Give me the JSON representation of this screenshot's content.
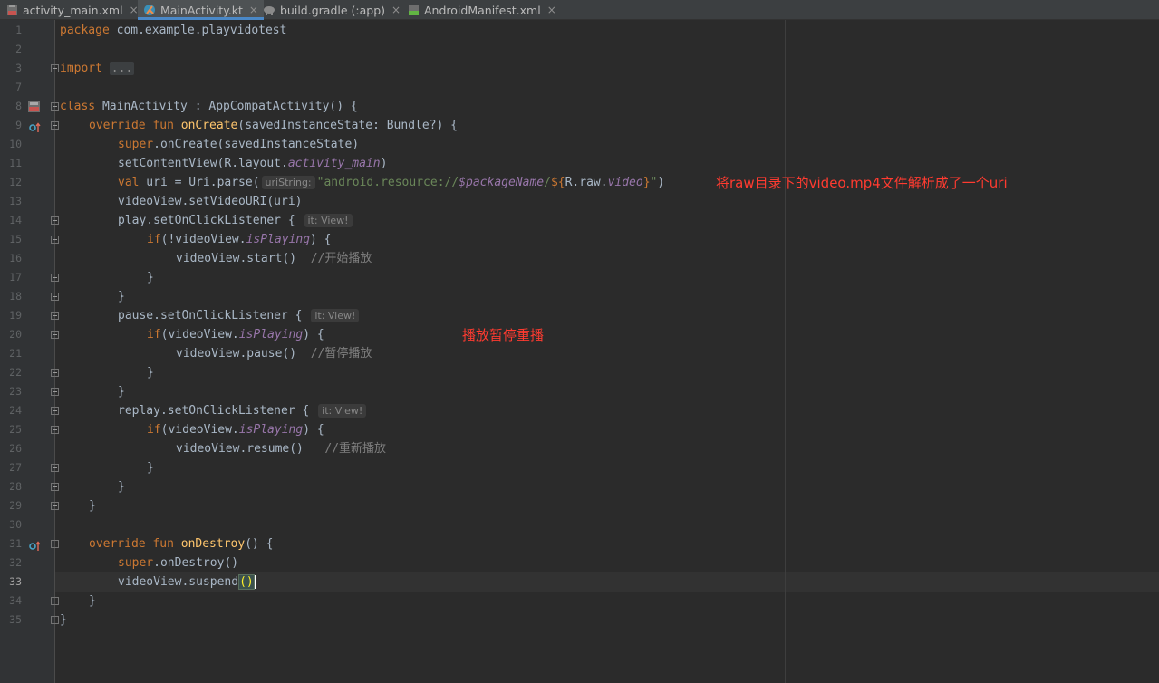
{
  "tabs": [
    {
      "label": "activity_main.xml",
      "icon": "xml-layout-icon",
      "active": false
    },
    {
      "label": "MainActivity.kt",
      "icon": "kotlin-class-icon",
      "active": true
    },
    {
      "label": "build.gradle (:app)",
      "icon": "gradle-elephant-icon",
      "active": false
    },
    {
      "label": "AndroidManifest.xml",
      "icon": "manifest-icon",
      "active": false
    }
  ],
  "close_glyph": "×",
  "line_numbers": [
    "1",
    "2",
    "3",
    "7",
    "8",
    "9",
    "10",
    "11",
    "12",
    "13",
    "14",
    "15",
    "16",
    "17",
    "18",
    "19",
    "20",
    "21",
    "22",
    "23",
    "24",
    "25",
    "26",
    "27",
    "28",
    "29",
    "30",
    "31",
    "32",
    "33",
    "34",
    "35"
  ],
  "current_line": "33",
  "code": {
    "package_kw": "package",
    "package_name": " com.example.playvidotest",
    "import_kw": "import",
    "import_fold": "...",
    "class_kw": "class",
    "class_decl": " MainActivity : AppCompatActivity() {",
    "override_kw": "override fun",
    "oncreate_name": "onCreate",
    "oncreate_params": "(savedInstanceState: Bundle?) {",
    "super_kw": "super",
    "super_oncreate": ".onCreate(savedInstanceState)",
    "setcontent_a": "setContentView(R.layout.",
    "setcontent_it": "activity_main",
    "setcontent_b": ")",
    "val_kw": "val",
    "uri_a": " uri = Uri.parse(",
    "uri_hint": "uriString:",
    "uri_str_a": "\"android.resource://",
    "uri_pkg": "$packageName",
    "uri_str_b": "/",
    "uri_tmpl_a": "${",
    "uri_raw": "R.raw.",
    "uri_video": "video",
    "uri_tmpl_b": "}",
    "uri_str_c": "\"",
    "uri_close": ")",
    "setvideo": "videoView.setVideoURI(uri)",
    "play_listener": "play.setOnClickListener {",
    "listener_hint": "it: View!",
    "if_kw": "if",
    "if_not_a": "(!videoView.",
    "is_playing": "isPlaying",
    "if_close": ") {",
    "start_call": "videoView.start()",
    "start_comment": "//开始播放",
    "close_brace": "}",
    "pause_listener": "pause.setOnClickListener {",
    "if_a": "(videoView.",
    "pause_call": "videoView.pause()",
    "pause_comment": "//暂停播放",
    "replay_listener": "replay.setOnClickListener {",
    "resume_call": "videoView.resume()",
    "resume_comment": "//重新播放",
    "ondestroy_name": "onDestroy",
    "ondestroy_params": "() {",
    "super_ondestroy": ".onDestroy()",
    "suspend_call": "videoView.suspend",
    "suspend_parens": "()"
  },
  "annotations": {
    "uri_note": "将raw目录下的video.mp4文件解析成了一个uri",
    "buttons_note": "播放暂停重播"
  },
  "colors": {
    "keyword": "#cc7832",
    "function": "#ffc66d",
    "string": "#6a8759",
    "property": "#9876aa",
    "comment": "#808080",
    "annotation": "#ff3b30"
  }
}
